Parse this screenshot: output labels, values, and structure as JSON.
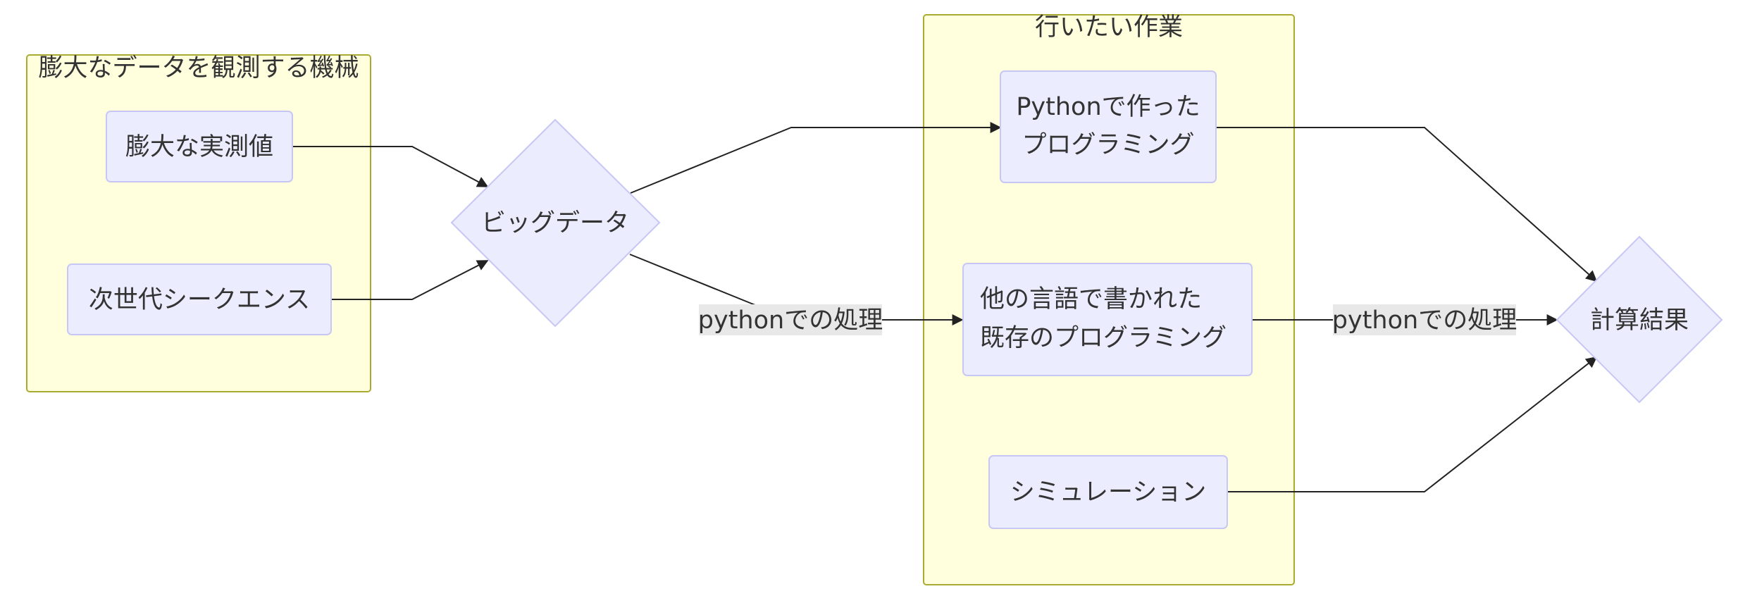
{
  "clusters": {
    "machines": {
      "title": "膨大なデータを観測する機械"
    },
    "tasks": {
      "title": "行いたい作業"
    }
  },
  "nodes": {
    "measured": "膨大な実測値",
    "ngs": "次世代シークエンス",
    "bigdata": "ビッグデータ",
    "python_prog": [
      "Pythonで作った",
      "プログラミング"
    ],
    "other_lang": [
      "他の言語で書かれた",
      "既存のプログラミング"
    ],
    "simulation": "シミュレーション",
    "result": "計算結果"
  },
  "edge_labels": {
    "bigdata_to_other": "pythonでの処理",
    "other_to_result": "pythonでの処理"
  },
  "colors": {
    "cluster_fill": "#ffffde",
    "cluster_stroke": "#aaaa33",
    "node_fill": "#ececff",
    "node_stroke": "#c7c7f5",
    "edge": "#222222",
    "label_bg": "#e8e8e8"
  }
}
